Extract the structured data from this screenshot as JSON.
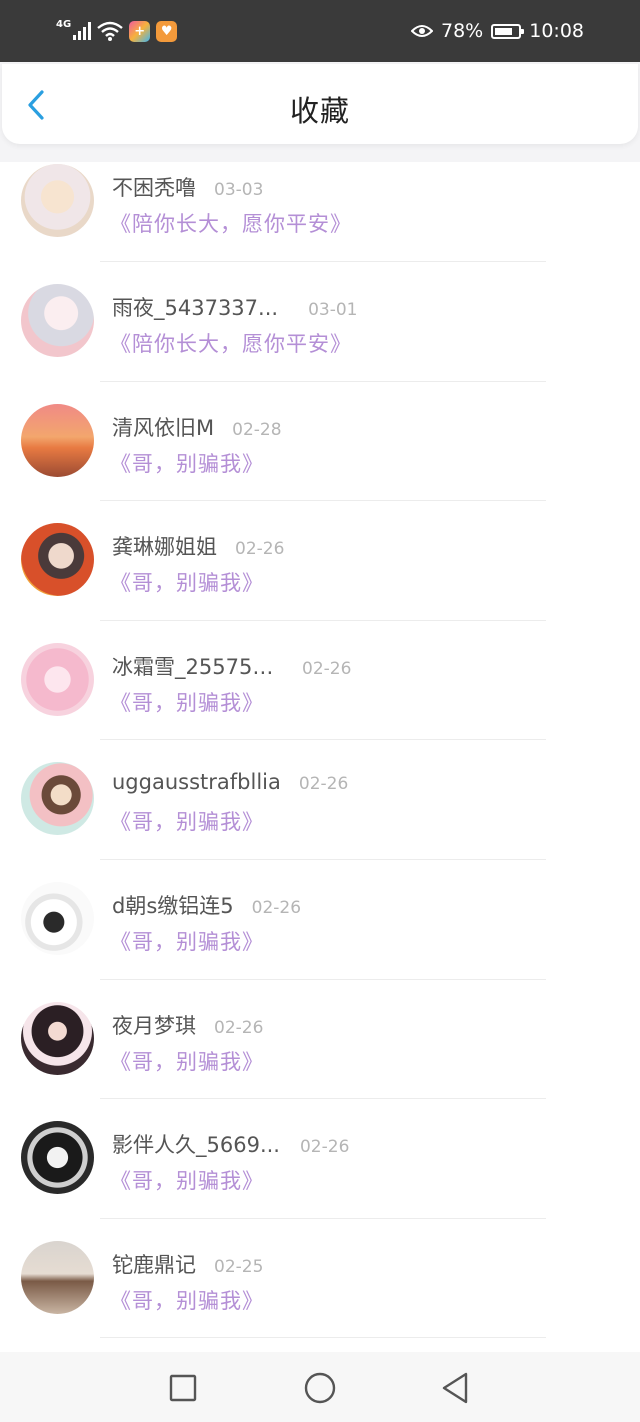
{
  "status_bar": {
    "network": "4G",
    "battery_percent": "78%",
    "battery_level": 0.78,
    "time": "10:08",
    "app_icons": [
      "app-icon-plus",
      "app-icon-heart"
    ]
  },
  "header": {
    "title": "收藏",
    "back_icon": "chevron-left-icon"
  },
  "colors": {
    "accent": "#2a9fe0",
    "book_title": "#b48fd6",
    "name": "#555555",
    "date": "#b5b5b5"
  },
  "favorites": [
    {
      "name": "不困秃噜",
      "date": "03-03",
      "book": "《陪你长大，愿你平安》"
    },
    {
      "name": "雨夜_5437337...",
      "date": "03-01",
      "book": "《陪你长大，愿你平安》"
    },
    {
      "name": "清风依旧M",
      "date": "02-28",
      "book": "《哥，别骗我》"
    },
    {
      "name": "龚琳娜姐姐",
      "date": "02-26",
      "book": "《哥，别骗我》"
    },
    {
      "name": "冰霜雪_255758...",
      "date": "02-26",
      "book": "《哥，别骗我》"
    },
    {
      "name": "uggausstrafbllia",
      "date": "02-26",
      "book": "《哥，别骗我》"
    },
    {
      "name": "d朝s缴铝连5",
      "date": "02-26",
      "book": "《哥，别骗我》"
    },
    {
      "name": "夜月梦琪",
      "date": "02-26",
      "book": "《哥，别骗我》"
    },
    {
      "name": "影伴人久_5669...",
      "date": "02-26",
      "book": "《哥，别骗我》"
    },
    {
      "name": "铊鹿鼎记",
      "date": "02-25",
      "book": "《哥，别骗我》"
    }
  ],
  "nav_bar": {
    "buttons": [
      "recent-apps-icon",
      "home-icon",
      "back-triangle-icon"
    ]
  }
}
